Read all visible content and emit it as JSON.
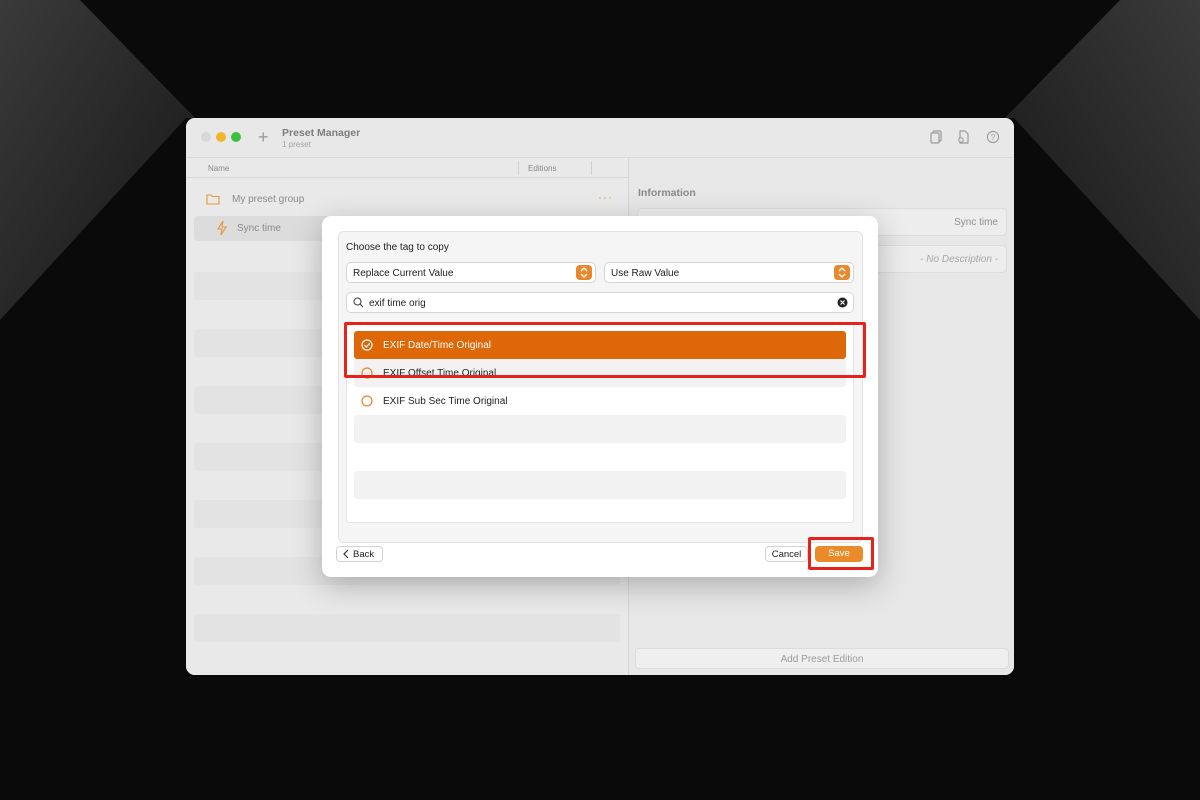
{
  "window": {
    "title": "Preset Manager",
    "subtitle": "1 preset",
    "toolbar_icons": [
      "plus-icon",
      "documents-icon",
      "export-icon",
      "help-icon"
    ]
  },
  "left_panel": {
    "columns": {
      "name": "Name",
      "editions": "Editions"
    },
    "group": {
      "label": "My preset group",
      "icon": "folder-icon",
      "menu": "···"
    },
    "preset": {
      "label": "Sync time",
      "icon": "bolt-icon"
    }
  },
  "right_panel": {
    "section_title": "Information",
    "name_value": "Sync time",
    "description_placeholder": "- No Description -",
    "add_edition_label": "Add Preset Edition"
  },
  "modal": {
    "prompt": "Choose the tag to copy",
    "mode_select": "Replace Current Value",
    "value_select": "Use Raw Value",
    "search_value": "exif time orig",
    "results": [
      {
        "label": "EXIF Date/Time Original",
        "selected": true
      },
      {
        "label": "EXIF Offset Time Original",
        "selected": false
      },
      {
        "label": "EXIF Sub Sec Time Original",
        "selected": false
      }
    ],
    "back_label": "Back",
    "cancel_label": "Cancel",
    "save_label": "Save"
  },
  "colors": {
    "accent": "#e98b2a",
    "selected_row": "#de6707",
    "highlight": "#e5231b"
  }
}
